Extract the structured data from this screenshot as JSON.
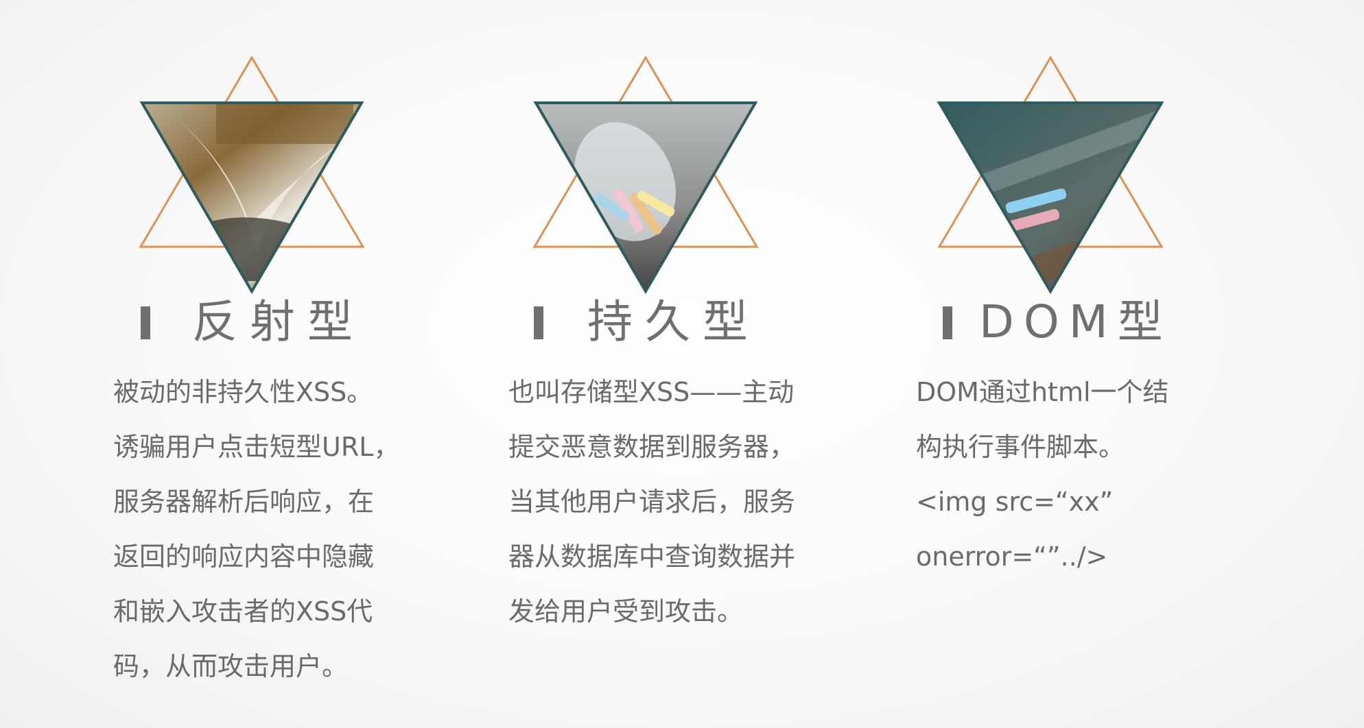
{
  "accent_orange": "#e09050",
  "accent_teal": "#2f5b5f",
  "cards": [
    {
      "title": "反射型",
      "image_icon": "open-book-photo",
      "lines": [
        "被动的非持久性XSS。",
        "诱骗用户点击短型URL，",
        "服务器解析后响应，在",
        "返回的响应内容中隐藏",
        "和嵌入攻击者的XSS代",
        "码，从而攻击用户。"
      ]
    },
    {
      "title": "持久型",
      "image_icon": "chalk-jar-photo",
      "lines": [
        "也叫存储型XSS——主动",
        "提交恶意数据到服务器，",
        "当其他用户请求后，服务",
        "器从数据库中查询数据并",
        "发给用户受到攻击。"
      ]
    },
    {
      "title": "DOM型",
      "image_icon": "chalkboard-photo",
      "lines": [
        "DOM通过html一个结",
        "构执行事件脚本。",
        "<img src=“xx”",
        "onerror=“”../>"
      ]
    }
  ]
}
